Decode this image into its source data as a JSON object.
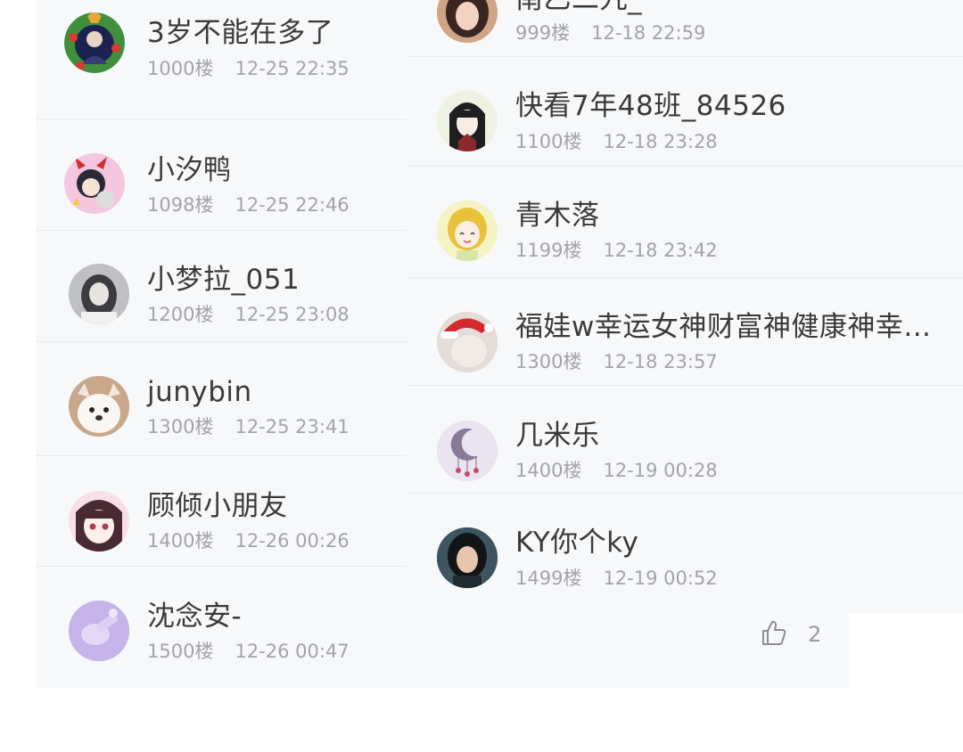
{
  "left_list": [
    {
      "name": "3岁不能在多了",
      "floor": "1000楼",
      "time": "12-25 22:35",
      "avatar": "christmas-wreath-avatar"
    },
    {
      "name": "小汐鸭",
      "floor": "1098楼",
      "time": "12-25 22:46",
      "avatar": "devil-horns-anime-avatar"
    },
    {
      "name": "小梦拉_051",
      "floor": "1200楼",
      "time": "12-25 23:08",
      "avatar": "grayscale-girl-avatar"
    },
    {
      "name": "junybin",
      "floor": "1300楼",
      "time": "12-25 23:41",
      "avatar": "puppy-avatar"
    },
    {
      "name": "顾倾小朋友",
      "floor": "1400楼",
      "time": "12-26 00:26",
      "avatar": "anime-girl-avatar"
    },
    {
      "name": "沈念安-",
      "floor": "1500楼",
      "time": "12-26 00:47",
      "avatar": "purple-hand-avatar"
    }
  ],
  "right_list": [
    {
      "name": "南乙二九_",
      "floor": "999楼",
      "time": "12-18 22:59",
      "avatar": "girl-photo-avatar"
    },
    {
      "name": "快看7年48班_84526",
      "floor": "1100楼",
      "time": "12-18 23:28",
      "avatar": "black-hair-anime-avatar"
    },
    {
      "name": "青木落",
      "floor": "1199楼",
      "time": "12-18 23:42",
      "avatar": "blonde-cartoon-avatar"
    },
    {
      "name": "福娃w幸运女神财富神健康神幸...",
      "floor": "1300楼",
      "time": "12-18 23:57",
      "avatar": "santa-hat-avatar"
    },
    {
      "name": "几米乐",
      "floor": "1400楼",
      "time": "12-19 00:28",
      "avatar": "moon-dreamcatcher-avatar"
    },
    {
      "name": "KY你个ky",
      "floor": "1499楼",
      "time": "12-19 00:52",
      "avatar": "woman-portrait-avatar"
    }
  ],
  "like": {
    "count": "2",
    "icon": "thumbs-up-icon"
  }
}
